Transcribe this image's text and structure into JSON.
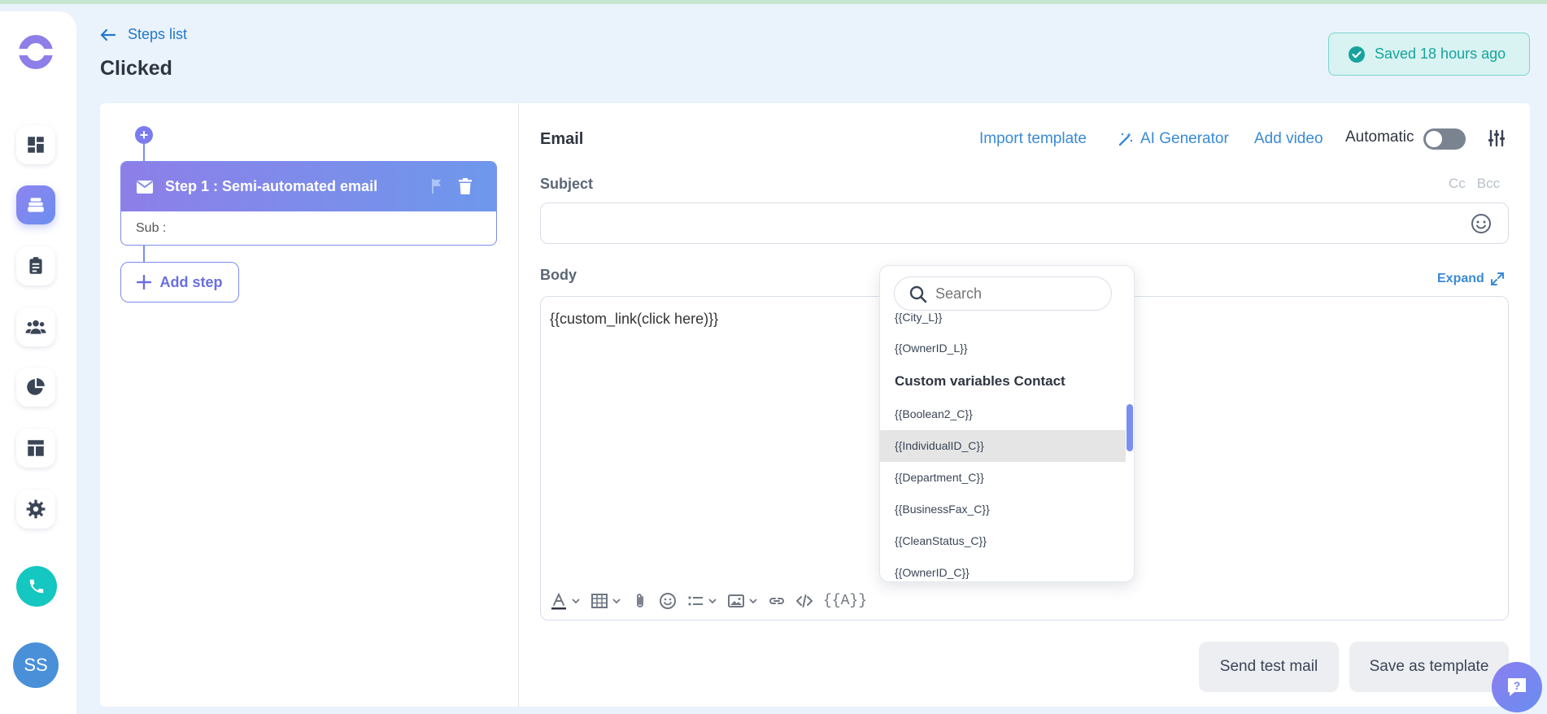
{
  "header": {
    "back_label": "Steps list",
    "page_title": "Clicked",
    "saved_status": "Saved 18 hours ago"
  },
  "sidebar": {
    "items": [
      {
        "icon": "dashboard-icon"
      },
      {
        "icon": "sequences-icon",
        "active": true
      },
      {
        "icon": "tasks-icon"
      },
      {
        "icon": "contacts-icon"
      },
      {
        "icon": "reports-icon"
      },
      {
        "icon": "templates-icon"
      },
      {
        "icon": "gear-icon"
      }
    ],
    "phone_icon": "phone-icon",
    "avatar_initials": "SS"
  },
  "steps": {
    "step1": {
      "title": "Step 1 : Semi-automated email",
      "sub_label": "Sub :"
    },
    "add_step_label": "Add step"
  },
  "editor": {
    "section_title": "Email",
    "import_template_label": "Import template",
    "ai_generator_label": "AI Generator",
    "add_video_label": "Add video",
    "automatic_label": "Automatic",
    "automatic_on": false,
    "subject_label": "Subject",
    "cc_label": "Cc",
    "bcc_label": "Bcc",
    "subject_value": "",
    "body_label": "Body",
    "expand_label": "Expand",
    "body_text": "{{custom_link(click here)}}",
    "variable_button": "{{A}}"
  },
  "variable_dropdown": {
    "search_placeholder": "Search",
    "items_before": [
      "{{City_L}}",
      "{{OwnerID_L}}"
    ],
    "section_heading": "Custom variables Contact",
    "items": [
      "{{Boolean2_C}}",
      "{{IndividualID_C}}",
      "{{Department_C}}",
      "{{BusinessFax_C}}",
      "{{CleanStatus_C}}",
      "{{OwnerID_C}}"
    ],
    "highlighted": "{{IndividualID_C}}"
  },
  "footer": {
    "send_test_label": "Send test mail",
    "save_template_label": "Save as template"
  },
  "colors": {
    "accent": "#7c8df0",
    "link": "#3a8ad6",
    "success": "#17a39d",
    "phone": "#14c7c0"
  }
}
